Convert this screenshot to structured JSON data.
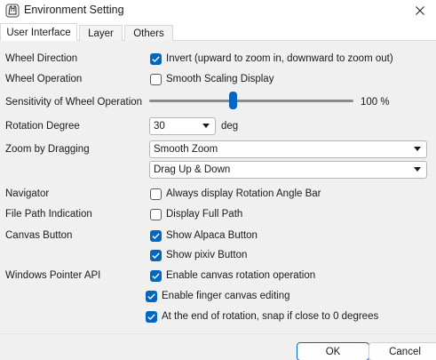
{
  "window": {
    "title": "Environment Setting",
    "icon": "alpaca-app-icon"
  },
  "tabs": [
    {
      "label": "User Interface",
      "active": true
    },
    {
      "label": "Layer",
      "active": false
    },
    {
      "label": "Others",
      "active": false
    }
  ],
  "labels": {
    "wheel_direction": "Wheel Direction",
    "wheel_operation": "Wheel Operation",
    "sensitivity": "Sensitivity of Wheel Operation",
    "rotation_degree": "Rotation Degree",
    "zoom_by_dragging": "Zoom by Dragging",
    "navigator": "Navigator",
    "file_path": "File Path Indication",
    "canvas_button": "Canvas Button",
    "pointer_api": "Windows Pointer API"
  },
  "options": {
    "invert": {
      "label": "Invert (upward to zoom in, downward to zoom out)",
      "checked": true
    },
    "smooth_scaling": {
      "label": "Smooth Scaling Display",
      "checked": false
    },
    "rotation_bar": {
      "label": "Always display Rotation Angle Bar",
      "checked": false
    },
    "full_path": {
      "label": "Display Full Path",
      "checked": false
    },
    "alpaca_button": {
      "label": "Show Alpaca Button",
      "checked": true
    },
    "pixiv_button": {
      "label": "Show pixiv Button",
      "checked": true
    },
    "canvas_rotation": {
      "label": "Enable canvas rotation operation",
      "checked": true
    },
    "finger_editing": {
      "label": "Enable finger canvas editing",
      "checked": true
    },
    "snap_zero": {
      "label": "At the end of rotation, snap if close to 0 degrees",
      "checked": true
    }
  },
  "sensitivity": {
    "value_text": "100 %",
    "level": 0.4
  },
  "rotation": {
    "value": "30",
    "unit": "deg"
  },
  "zoom_mode": {
    "value": "Smooth Zoom"
  },
  "drag_direction": {
    "value": "Drag Up & Down"
  },
  "buttons": {
    "ok": "OK",
    "cancel": "Cancel"
  },
  "colors": {
    "accent": "#0067c0",
    "panel": "#f0f0f0"
  }
}
